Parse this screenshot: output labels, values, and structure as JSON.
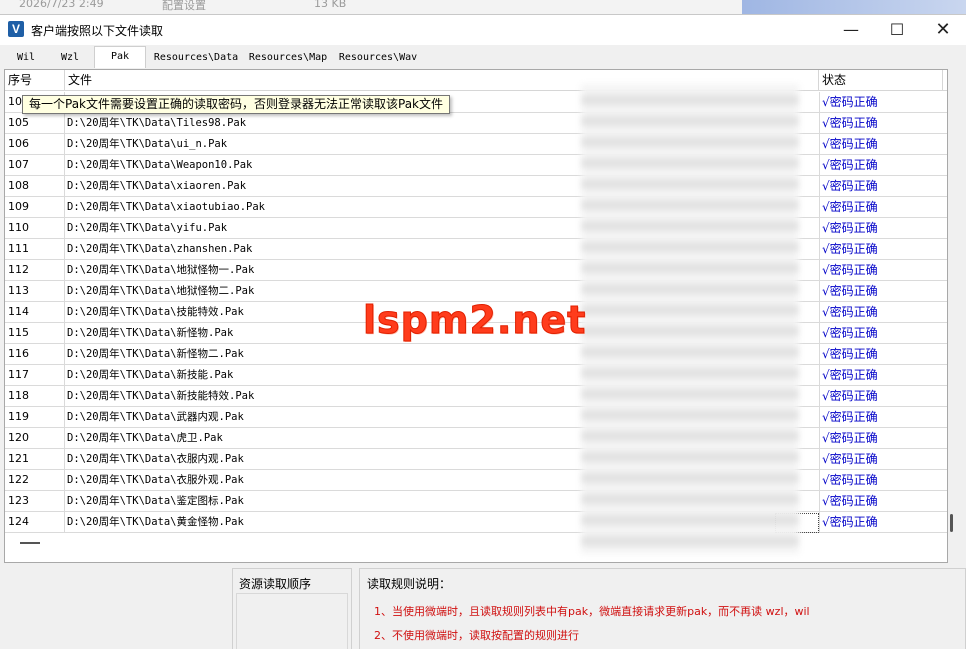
{
  "background": {
    "datetime": "2026/7/23 2:49",
    "desc": "配置设置",
    "size": "13 KB"
  },
  "window": {
    "title": "客户端按照以下文件读取",
    "icon_letter": "V",
    "minimize": "—",
    "maximize": "☐",
    "close": "✕"
  },
  "tabs": [
    "Wil",
    "Wzl",
    "Pak",
    "Resources\\Data",
    "Resources\\Map",
    "Resources\\Wav"
  ],
  "active_tab": "Pak",
  "table": {
    "headers": [
      "序号",
      "文件",
      "状态"
    ],
    "rows": [
      {
        "num": "104",
        "file": "",
        "status": "√密码正确"
      },
      {
        "num": "105",
        "file": "D:\\20周年\\TK\\Data\\Tiles98.Pak",
        "status": "√密码正确"
      },
      {
        "num": "106",
        "file": "D:\\20周年\\TK\\Data\\ui_n.Pak",
        "status": "√密码正确"
      },
      {
        "num": "107",
        "file": "D:\\20周年\\TK\\Data\\Weapon10.Pak",
        "status": "√密码正确"
      },
      {
        "num": "108",
        "file": "D:\\20周年\\TK\\Data\\xiaoren.Pak",
        "status": "√密码正确"
      },
      {
        "num": "109",
        "file": "D:\\20周年\\TK\\Data\\xiaotubiao.Pak",
        "status": "√密码正确"
      },
      {
        "num": "110",
        "file": "D:\\20周年\\TK\\Data\\yifu.Pak",
        "status": "√密码正确"
      },
      {
        "num": "111",
        "file": "D:\\20周年\\TK\\Data\\zhanshen.Pak",
        "status": "√密码正确"
      },
      {
        "num": "112",
        "file": "D:\\20周年\\TK\\Data\\地狱怪物一.Pak",
        "status": "√密码正确"
      },
      {
        "num": "113",
        "file": "D:\\20周年\\TK\\Data\\地狱怪物二.Pak",
        "status": "√密码正确"
      },
      {
        "num": "114",
        "file": "D:\\20周年\\TK\\Data\\技能特效.Pak",
        "status": "√密码正确"
      },
      {
        "num": "115",
        "file": "D:\\20周年\\TK\\Data\\新怪物.Pak",
        "status": "√密码正确"
      },
      {
        "num": "116",
        "file": "D:\\20周年\\TK\\Data\\新怪物二.Pak",
        "status": "√密码正确"
      },
      {
        "num": "117",
        "file": "D:\\20周年\\TK\\Data\\新技能.Pak",
        "status": "√密码正确"
      },
      {
        "num": "118",
        "file": "D:\\20周年\\TK\\Data\\新技能特效.Pak",
        "status": "√密码正确"
      },
      {
        "num": "119",
        "file": "D:\\20周年\\TK\\Data\\武器内观.Pak",
        "status": "√密码正确"
      },
      {
        "num": "120",
        "file": "D:\\20周年\\TK\\Data\\虎卫.Pak",
        "status": "√密码正确"
      },
      {
        "num": "121",
        "file": "D:\\20周年\\TK\\Data\\衣服内观.Pak",
        "status": "√密码正确"
      },
      {
        "num": "122",
        "file": "D:\\20周年\\TK\\Data\\衣服外观.Pak",
        "status": "√密码正确"
      },
      {
        "num": "123",
        "file": "D:\\20周年\\TK\\Data\\鉴定图标.Pak",
        "status": "√密码正确"
      },
      {
        "num": "124",
        "file": "D:\\20周年\\TK\\Data\\黄金怪物.Pak",
        "status": "√密码正确"
      }
    ]
  },
  "tooltip": "每一个Pak文件需要设置正确的读取密码，否则登录器无法正常读取该Pak文件",
  "watermark": "lspm2.net",
  "panels": {
    "order_title": "资源读取顺序",
    "rules_title": "读取规则说明：",
    "rules": [
      "1、当使用微端时，且读取规则列表中有pak，微端直接请求更新pak，而不再读 wzl，wil",
      "2、不使用微端时，读取按配置的规则进行"
    ]
  },
  "colors": {
    "status_text": "#0000c8",
    "rule_text": "#d01010",
    "tooltip_bg": "#ffffe1",
    "watermark": "#ff3c1c"
  }
}
